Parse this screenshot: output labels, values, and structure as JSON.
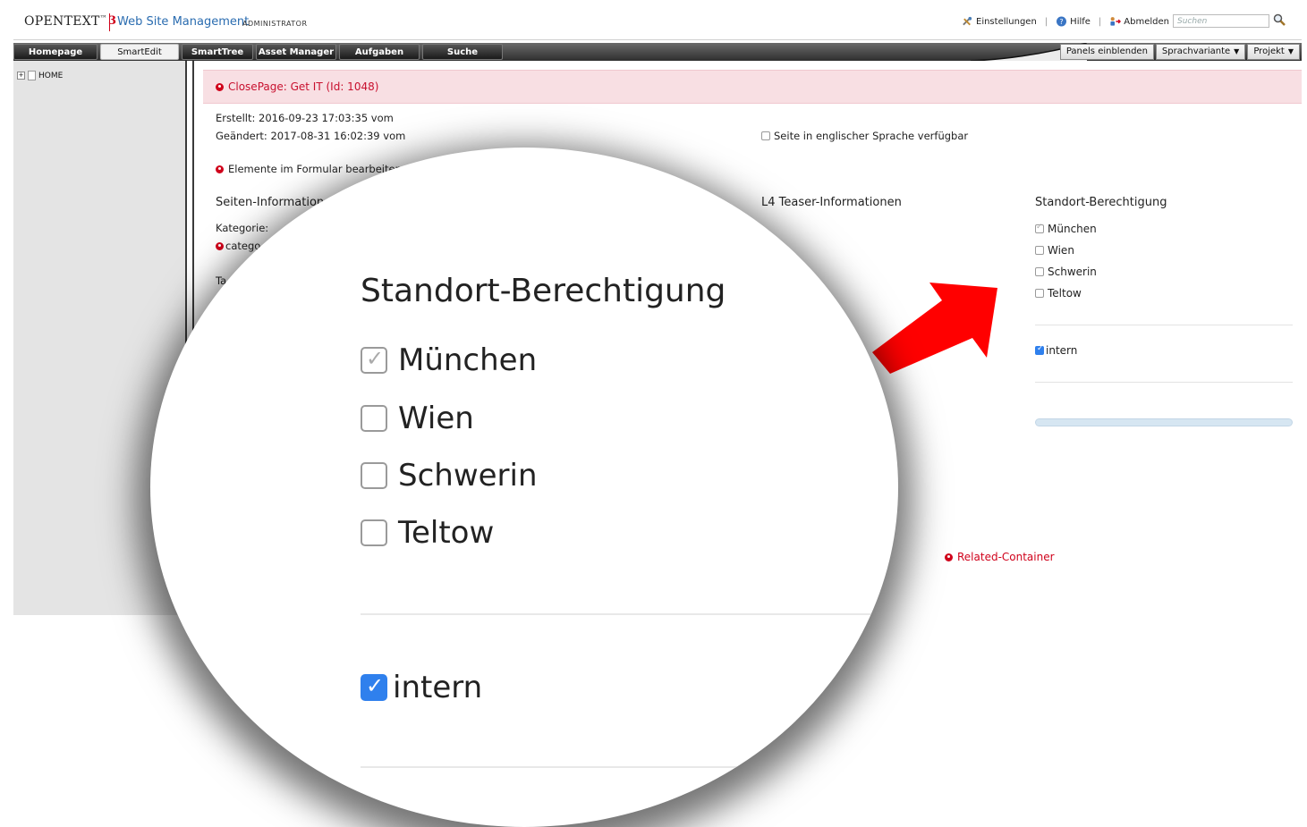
{
  "header": {
    "brand": "OPENTEXT",
    "brand_tm": "™",
    "brand_version": "3",
    "product": "Web Site Management",
    "role": "ADMINISTRATOR",
    "settings_label": "Einstellungen",
    "help_label": "Hilfe",
    "logout_label": "Abmelden",
    "search_placeholder": "Suchen"
  },
  "nav": {
    "tabs": [
      {
        "label": "Homepage"
      },
      {
        "label": "SmartEdit"
      },
      {
        "label": "SmartTree"
      },
      {
        "label": "Asset Manager"
      },
      {
        "label": "Aufgaben"
      },
      {
        "label": "Suche"
      }
    ],
    "active_tab": "SmartEdit",
    "panels_label": "Panels einblenden",
    "language_label": "Sprachvariante",
    "project_label": "Projekt"
  },
  "tree": {
    "root_label": "HOME"
  },
  "page": {
    "title": "ClosePage: Get IT (Id: 1048)",
    "created": "Erstellt: 2016-09-23 17:03:35 vom",
    "changed": "Geändert: 2017-08-31 16:02:39 vom",
    "english_available": "Seite in englischer Sprache verfügbar",
    "edit_elements": "Elemente im Formular bearbeiten",
    "page_info_heading": "Seiten-Information",
    "category_label": "Kategorie:",
    "category_value": "catego",
    "tag_label": "Ta",
    "teaser_heading": "L4 Teaser-Informationen",
    "related_label": "Related-Container"
  },
  "location_permission": {
    "heading": "Standort-Berechtigung",
    "locations": [
      {
        "label": "München",
        "checked": true,
        "disabled": true
      },
      {
        "label": "Wien",
        "checked": false
      },
      {
        "label": "Schwerin",
        "checked": false
      },
      {
        "label": "Teltow",
        "checked": false
      }
    ],
    "intern_label": "intern",
    "intern_checked": true
  },
  "colors": {
    "accent_red": "#d0021b",
    "checkbox_blue": "#2f80ed",
    "page_bar_bg": "#f8dfe3",
    "arrow_red": "#ff0000"
  }
}
